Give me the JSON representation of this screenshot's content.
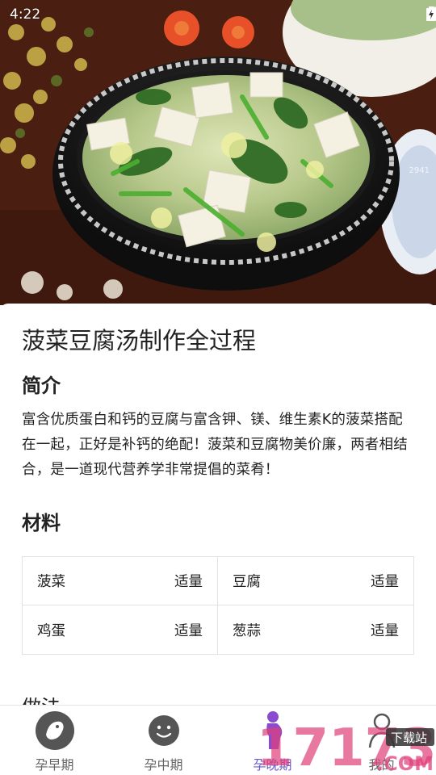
{
  "status_bar": {
    "time": "4:22"
  },
  "hero": {
    "watermark_text": "2941"
  },
  "recipe": {
    "title": "菠菜豆腐汤制作全过程",
    "intro_heading": "简介",
    "intro_text": "富含优质蛋白和钙的豆腐与富含钾、镁、维生素K的菠菜搭配在一起，正好是补钙的绝配！菠菜和豆腐物美价廉，两者相结合，是一道现代营养学非常提倡的菜肴！",
    "materials_heading": "材料",
    "materials": [
      {
        "name": "菠菜",
        "amount": "适量"
      },
      {
        "name": "豆腐",
        "amount": "适量"
      },
      {
        "name": "鸡蛋",
        "amount": "适量"
      },
      {
        "name": "葱蒜",
        "amount": "适量"
      }
    ],
    "next_heading_partial": "做法"
  },
  "nav": {
    "items": [
      {
        "label": "孕早期",
        "icon": "baby-face-icon"
      },
      {
        "label": "孕中期",
        "icon": "smiley-face-icon"
      },
      {
        "label": "孕晚期",
        "icon": "pregnant-woman-icon"
      },
      {
        "label": "我的",
        "icon": "person-icon"
      }
    ],
    "active_index": 2,
    "active_color": "#6a5acd",
    "inactive_color": "#666666"
  },
  "watermark": {
    "text_main": "17173",
    "text_sub": "下载站",
    "text_domain": ".COM"
  }
}
